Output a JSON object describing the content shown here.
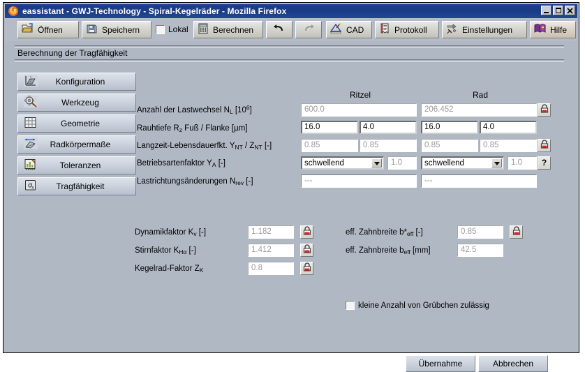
{
  "window": {
    "title": "eassistant - GWJ-Technology - Spiral-Kegelräder - Mozilla Firefox",
    "app_icon": "firefox-icon",
    "minimize_label": "_",
    "maximize_label": "□",
    "close_label": "X"
  },
  "toolbar": {
    "buttons": [
      {
        "label": "Öffnen",
        "icon": "open-folder-icon"
      },
      {
        "label": "Speichern",
        "icon": "floppy-disk-icon"
      },
      {
        "label": "Berechnen",
        "icon": "calculator-icon"
      },
      {
        "label": "CAD",
        "icon": "cad-drawing-icon"
      },
      {
        "label": "Protokoll",
        "icon": "report-document-icon"
      },
      {
        "label": "Einstellungen",
        "icon": "settings-tools-icon"
      },
      {
        "label": "Hilfe",
        "icon": "help-book-icon"
      }
    ],
    "undo_icon": "undo-arrow-icon",
    "redo_icon": "redo-arrow-icon",
    "lokal_checkbox": {
      "label": "Lokal",
      "checked": false
    }
  },
  "section": {
    "title": "Berechnung der Tragfähigkeit"
  },
  "sidebar": {
    "items": [
      {
        "label": "Konfiguration",
        "icon": "axes-config-icon"
      },
      {
        "label": "Werkzeug",
        "icon": "gear-tool-icon"
      },
      {
        "label": "Geometrie",
        "icon": "grid-geometry-icon"
      },
      {
        "label": "Radkörpermaße",
        "icon": "wheel-body-dimension-icon"
      },
      {
        "label": "Toleranzen",
        "icon": "tolerance-chart-icon"
      },
      {
        "label": "Tragfähigkeit",
        "icon": "sigma-x-icon"
      }
    ]
  },
  "main": {
    "column_headers": {
      "pinion": "Ritzel",
      "wheel": "Rad"
    },
    "rows": [
      {
        "label_html": "Anzahl der Lastwechsel N<sub>L</sub> [10<sup>6</sup>]",
        "pinion": "600.0",
        "wheel": "206.452",
        "lock": "lock-icon"
      },
      {
        "label_html": "Rauhtiefe R<sub>z</sub> Fuß / Flanke [µm]",
        "pinion_a": "16.0",
        "pinion_b": "4.0",
        "wheel_a": "16.0",
        "wheel_b": "4.0"
      },
      {
        "label_html": "Langzeit-Lebensdauerfkt. Y<sub>NT</sub> / Z<sub>NT</sub> [-]",
        "pinion_a": "0.85",
        "pinion_b": "0.85",
        "wheel_a": "0.85",
        "wheel_b": "0.85",
        "lock": "lock-icon"
      },
      {
        "label_html": "Betriebsartenfaktor Y<sub>A</sub> [-]",
        "pinion_select": "schwellend",
        "pinion_value": "1.0",
        "wheel_select": "schwellend",
        "wheel_value": "1.0",
        "help": "?"
      },
      {
        "label_html": "Lastrichtungsänderungen N<sub>rev</sub> [-]",
        "pinion": "---",
        "wheel": "---"
      }
    ],
    "lower_left": [
      {
        "label_html": "Dynamikfaktor K<sub>v</sub> [-]",
        "value": "1.182",
        "lock": "lock-icon"
      },
      {
        "label_html": "Stirnfaktor K<sub>Hα</sub> [-]",
        "value": "1.412",
        "lock": "lock-icon"
      },
      {
        "label_html": "Kegelrad-Faktor Z<sub>K</sub>",
        "value": "0.8",
        "lock": "lock-icon"
      }
    ],
    "lower_right": [
      {
        "label_html": "eff. Zahnbreite b*<sub>eff</sub> [-]",
        "value": "0.85",
        "lock": "lock-icon"
      },
      {
        "label_html": "eff. Zahnbreite b<sub>eff</sub> [mm]",
        "value": "42.5"
      }
    ],
    "pitting_checkbox": {
      "label": "kleine Anzahl von Grübchen zulässig",
      "checked": false
    }
  },
  "footer": {
    "accept_label": "Übernahme",
    "cancel_label": "Abbrechen"
  },
  "colors": {
    "titlebar": "#1d3f8f",
    "panel_bg": "#b0b8c4",
    "toolbar_bg": "#b5bcc7",
    "field_bg": "#ffffff",
    "readonly_text": "#9b9b9b",
    "lock_red": "#d8232a"
  }
}
